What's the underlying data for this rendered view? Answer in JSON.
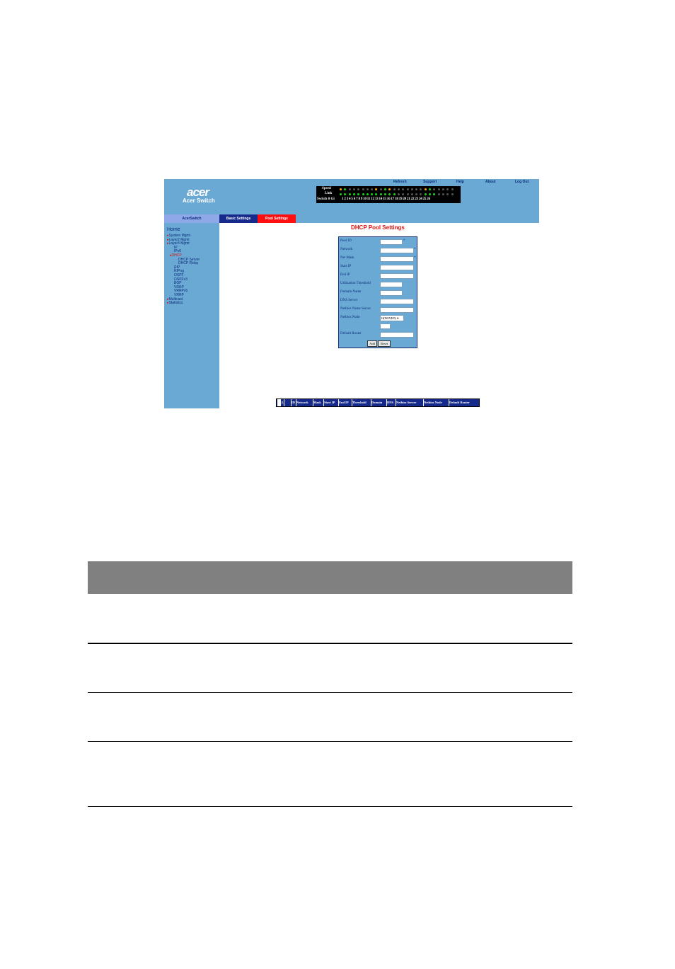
{
  "app": {
    "logo": "acer",
    "brand": "Acer Switch",
    "top_links": [
      "Refresh",
      "Support",
      "Help",
      "About",
      "Log Out"
    ]
  },
  "ports": {
    "speed_label": "Speed",
    "link_label": "Link",
    "switch_label": "Switch 0 Gi",
    "numbers": "1 2 3 4 5 6 7 8 9 10 11 12 13 14 15 16 17 18 19 20 21 22 23 24 25 26",
    "speed_colors": [
      "#f6a800",
      "#1cd21c",
      "#555555",
      "#555555",
      "#555555",
      "#555555",
      "#555555",
      "#555555",
      "#f6a800",
      "#555555",
      "#1cd21c",
      "#f6a800",
      "#555555",
      "#555555",
      "#555555",
      "#555555",
      "#555555",
      "#555555",
      "#555555",
      "#f6a800",
      "#1cd21c",
      "#555555",
      "#555555",
      "#555555",
      "#555555",
      "#555555"
    ],
    "link_colors": [
      "#1cd21c",
      "#1cd21c",
      "#1cd21c",
      "#1cd21c",
      "#1cd21c",
      "#1cd21c",
      "#1cd21c",
      "#1cd21c",
      "#1cd21c",
      "#1cd21c",
      "#1cd21c",
      "#1cd21c",
      "#1cd21c",
      "#555555",
      "#555555",
      "#555555",
      "#555555",
      "#555555",
      "#555555",
      "#1cd21c",
      "#1cd21c",
      "#1cd21c",
      "#555555",
      "#555555",
      "#555555",
      "#555555"
    ]
  },
  "tabs": {
    "home": "AcerSwitch",
    "basic": "Basic Settings",
    "pool": "Pool Settings"
  },
  "sidebar": {
    "home": "Home",
    "items": [
      {
        "label": "System Mgmt",
        "arrow": true
      },
      {
        "label": "Layer2 Mgmt",
        "arrow": true
      },
      {
        "label": "Layer3 Mgmt",
        "arrow": true
      },
      {
        "label": "IP",
        "arrow": false
      },
      {
        "label": "IPv6",
        "arrow": false
      },
      {
        "label": "DHCP",
        "arrow": true,
        "active": true
      },
      {
        "label": "DHCP Server",
        "arrow": false
      },
      {
        "label": "DHCP Relay",
        "arrow": false
      },
      {
        "label": "RIP",
        "arrow": false
      },
      {
        "label": "RIPng",
        "arrow": false
      },
      {
        "label": "OSPF",
        "arrow": false
      },
      {
        "label": "OSPFv3",
        "arrow": false
      },
      {
        "label": "BGP",
        "arrow": false
      },
      {
        "label": "VRRP",
        "arrow": false
      },
      {
        "label": "VRRPv6",
        "arrow": false
      },
      {
        "label": "VRRP",
        "arrow": false
      },
      {
        "label": "Multicast",
        "arrow": true
      },
      {
        "label": "Statistics",
        "arrow": true
      }
    ]
  },
  "form": {
    "title": "DHCP Pool Settings",
    "fields": [
      "Pool ID",
      "Network",
      "Net Mask",
      "Start IP",
      "End IP",
      "Utilization Threshold",
      "Domain Name",
      "DNS Server",
      "Netbios Name Server",
      "Netbios Node",
      "Default Router"
    ],
    "required_mark": "*",
    "netbios_node_value": "H(MIXED)",
    "add_label": "Add",
    "reset_label": "Reset"
  },
  "list": {
    "columns": [
      "ALL",
      "ID",
      "Network",
      "Mask",
      "Start IP",
      "End IP",
      "Threshold",
      "Domain",
      "DNS",
      "Netbios Server",
      "Netbios Node",
      "Default Router"
    ]
  }
}
